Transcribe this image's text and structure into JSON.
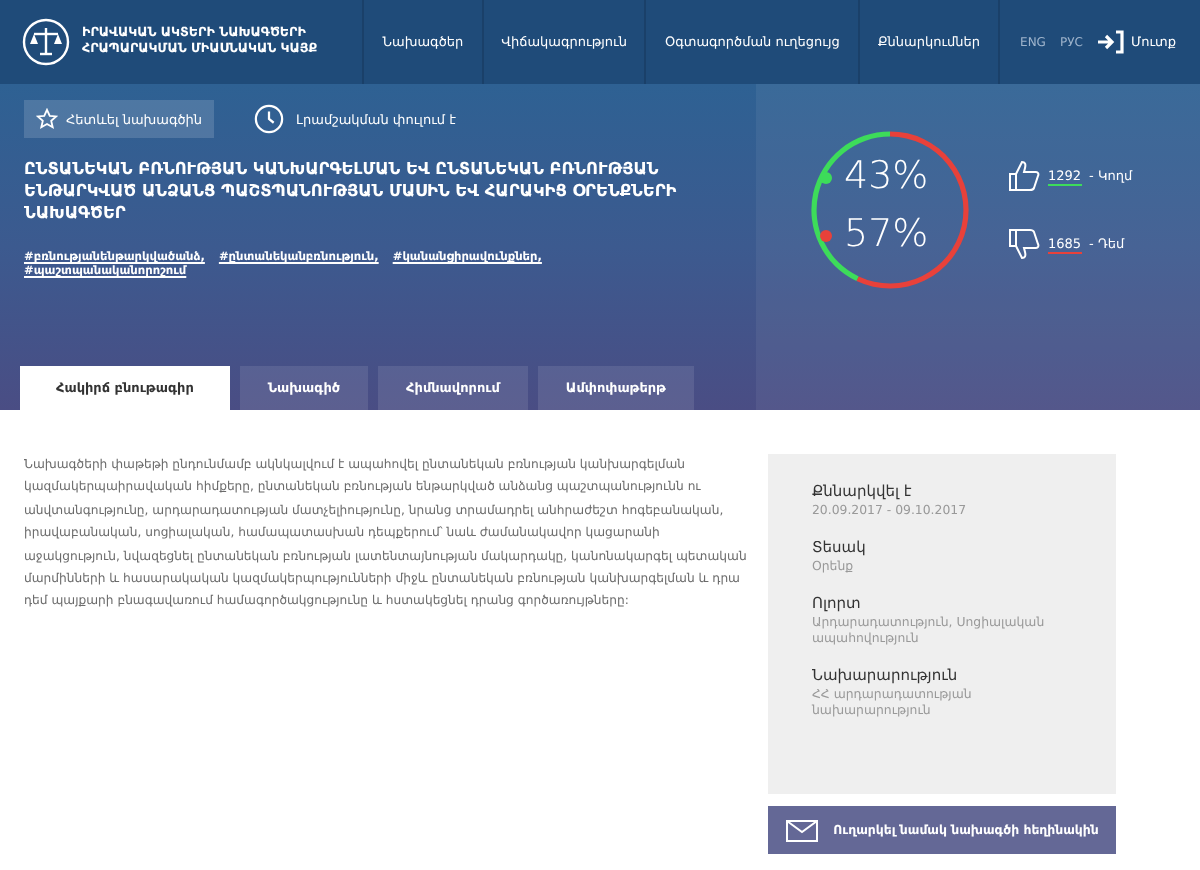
{
  "site": {
    "title_lines": [
      "ԻՐԱՎԱԿԱՆ ԱԿՏԵՐԻ ՆԱԽԱԳԾԵՐԻ",
      "ՀՐԱՊԱՐԱԿՄԱՆ ՄԻԱՍՆԱԿԱՆ ԿԱՅՔ"
    ]
  },
  "nav": {
    "items": [
      "Նախագծեր",
      "Վիճակագրություն",
      "Օգտագործման ուղեցույց",
      "Քննարկումներ"
    ],
    "languages": [
      "ENG",
      "РУС"
    ],
    "login": "Մուտք"
  },
  "project": {
    "follow_button": "Հետևել նախագծին",
    "status": "Լրամշակման փուլում է",
    "title": "ԸՆՏԱՆԵԿԱՆ ԲՌՆՈՒԹՅԱՆ ԿԱՆԽԱՐԳԵԼՄԱՆ ԵՎ ԸՆՏԱՆԵԿԱՆ ԲՌՆՈՒԹՅԱՆ ԵՆԹԱՐԿՎԱԾ ԱՆՁԱՆՑ ՊԱՇՏՊԱՆՈՒԹՅԱՆ ՄԱՍԻՆ ԵՎ ՀԱՐԱԿԻՑ ՕՐԵՆՔՆԵՐԻ ՆԱԽԱԳԾԵՐ",
    "tags": [
      "#բռնությանենթարկվածանձ,",
      "#ընտանեկանբռնություն,",
      "#կանանցիրավունքներ,",
      "#պաշտպանականորոշում"
    ]
  },
  "votes": {
    "chart_data": {
      "type": "donut",
      "values": [
        43,
        57
      ]
    },
    "shares": [
      {
        "label": "43%",
        "color": "#3ddc5a"
      },
      {
        "label": "57%",
        "color": "#e8413a"
      }
    ],
    "counts": [
      {
        "kind": "for",
        "count": "1292",
        "label": "- Կողմ",
        "color": "#3ddc5a"
      },
      {
        "kind": "against",
        "count": "1685",
        "label": "- Դեմ",
        "color": "#e8413a"
      }
    ]
  },
  "tabs": [
    {
      "label": "Հակիրճ բնութագիր",
      "selected": true
    },
    {
      "label": "Նախագիծ",
      "selected": false
    },
    {
      "label": "Հիմնավորում",
      "selected": false
    },
    {
      "label": "Ամփոփաթերթ",
      "selected": false
    }
  ],
  "summary": "Նախագծերի փաթեթի ընդունմամբ ակնկալվում է ապահովել ընտանեկան բռնության կանխարգելման կազմակերպաիրավական հիմքերը, ընտանեկան բռնության ենթարկված անձանց պաշտպանությունն ու անվտանգությունը, արդարադատության մատչելիությունը, նրանց տրամադրել անհրաժեշտ հոգեբանական, իրավաբանական, սոցիալական, համապատասխան դեպքերում՝ նաև ժամանակավոր կացարանի աջակցություն, նվազեցնել ընտանեկան բռնության լատենտայնության մակարդակը, կանոնակարգել պետական մարմինների և հասարակական կազմակերպությունների միջև ընտանեկան բռնության կանխարգելման և դրա դեմ պայքարի բնագավառում համագործակցությունը և հստակեցնել դրանց գործառույթները:",
  "details": [
    {
      "label": "Քննարկվել է",
      "value": "20.09.2017 - 09.10.2017"
    },
    {
      "label": "Տեսակ",
      "value": "Օրենք"
    },
    {
      "label": "Ոլորտ",
      "value": "Արդարադատություն, Սոցիալական ապահովություն"
    },
    {
      "label": "Նախարարություն",
      "value": "ՀՀ արդարադատության նախարարություն"
    }
  ],
  "contact_button": "Ուղարկել նամակ նախագծի հեղինակին"
}
